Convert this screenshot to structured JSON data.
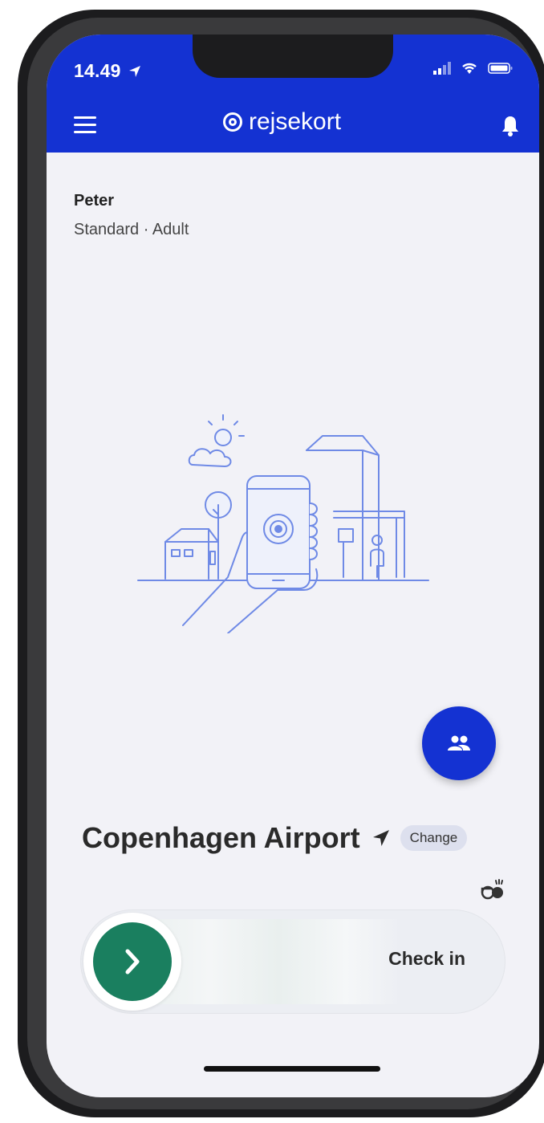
{
  "status_bar": {
    "time": "14.49"
  },
  "app": {
    "name": "rejsekort"
  },
  "user": {
    "name": "Peter",
    "profile": "Standard · Adult"
  },
  "location": {
    "station": "Copenhagen Airport",
    "change_label": "Change"
  },
  "checkin": {
    "label": "Check in"
  },
  "colors": {
    "brand": "#1432d2",
    "checkin": "#1a7f5f",
    "background": "#f2f2f7"
  }
}
